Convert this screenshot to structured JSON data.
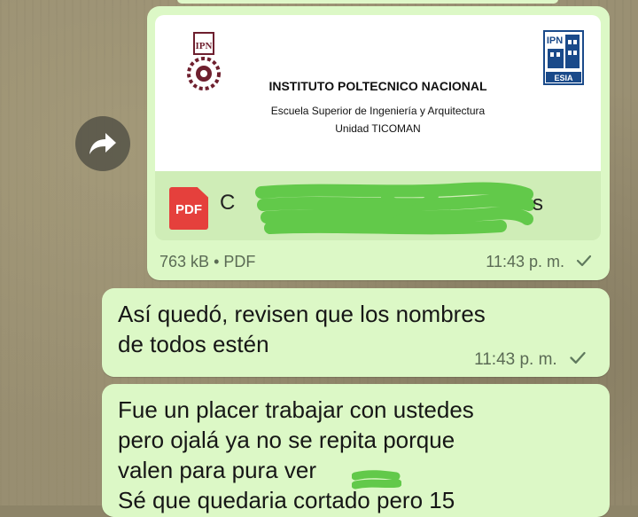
{
  "document_message": {
    "preview": {
      "institution": "INSTITUTO POLTECNICO NACIONAL",
      "school": "Escuela Superior de Ingeniería y Arquitectura",
      "unit": "Unidad TICOMAN",
      "left_logo_text": "IPN",
      "right_logo_text_top": "IPN",
      "right_logo_text_bottom": "ESIA"
    },
    "file_icon_label": "PDF",
    "file_name_visible": "C",
    "file_name_trailing": "s",
    "file_size": "763 kB",
    "separator": "•",
    "file_type": "PDF",
    "time": "11:43 p. m.",
    "status_icon": "single-check-icon"
  },
  "messages": [
    {
      "lines": [
        "Así quedó, revisen que los nombres",
        "de todos estén"
      ],
      "time": "11:43 p. m.",
      "status_icon": "single-check-icon"
    },
    {
      "lines": [
        "Fue un placer trabajar con ustedes",
        "pero ojalá ya no se repita porque",
        "valen para pura ver",
        "Sé que quedaria cortado pero 15"
      ]
    }
  ],
  "colors": {
    "bubble": "#dcf8c6",
    "file_row": "#cfedb7",
    "scribble": "#62c94a",
    "pdf_red": "#e5403c",
    "ipn_maroon": "#6e1f2e",
    "esia_blue": "#1a4a8a"
  }
}
